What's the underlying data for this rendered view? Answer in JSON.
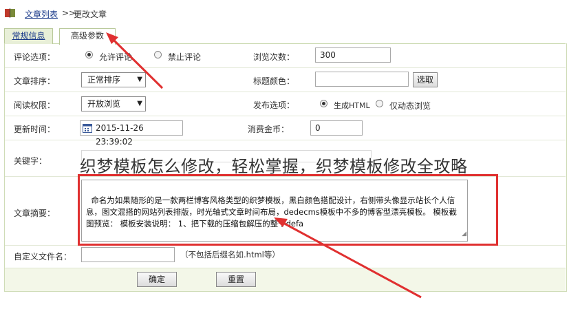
{
  "breadcrumb": {
    "link": "文章列表",
    "separator": ">>",
    "current": "更改文章"
  },
  "tabs": [
    {
      "label": "常规信息"
    },
    {
      "label": "高级参数"
    }
  ],
  "form": {
    "comment": {
      "label": "评论选项：",
      "options": [
        "允许评论",
        "禁止评论"
      ],
      "selected": 0
    },
    "views": {
      "label": "浏览次数：",
      "value": "300"
    },
    "sort": {
      "label": "文章排序：",
      "value": "正常排序"
    },
    "title_color": {
      "label": "标题颜色：",
      "value": "",
      "button": "选取"
    },
    "read_perm": {
      "label": "阅读权限：",
      "value": "开放浏览"
    },
    "publish": {
      "label": "发布选项：",
      "options": [
        "生成HTML",
        "仅动态浏览"
      ],
      "selected": 0
    },
    "update_time": {
      "label": "更新时间：",
      "value": "2015-11-26 23:39:02"
    },
    "coins": {
      "label": "消费金币：",
      "value": "0"
    },
    "keywords": {
      "label": "关键字："
    },
    "summary": {
      "label": "文章摘要：",
      "value": "命名为如果随形的是一款两栏博客风格类型的织梦模板，黑白颜色搭配设计，右侧带头像显示站长个人信息，图文混搭的网站列表排版，时光轴式文章时间布局，dedecms模板中不多的博客型漂亮模板。 模板截图预览： 模板安装说明： 1、把下载的压缩包解压的整个defa"
    },
    "filename": {
      "label": "自定义文件名：",
      "value": "",
      "hint": "（不包括后缀名如.html等）"
    }
  },
  "buttons": {
    "ok": "确定",
    "reset": "重置"
  },
  "overlay_title": "织梦模板怎么修改，轻松掌握，织梦模板修改全攻略",
  "colors": {
    "annotation_red": "#e03030",
    "link_blue": "#1a3a8a",
    "tab_green": "#e8efd8",
    "footer_bg": "#f3f7e8"
  }
}
